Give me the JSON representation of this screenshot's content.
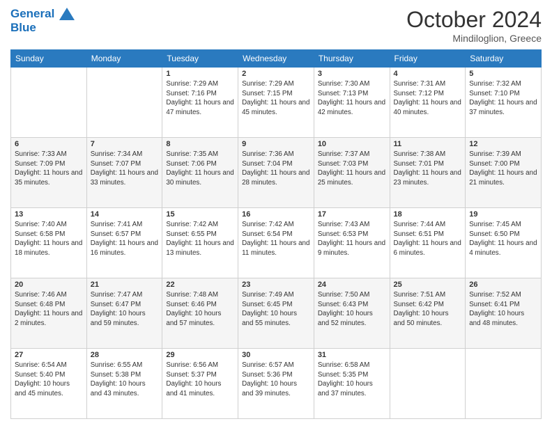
{
  "header": {
    "logo_line1": "General",
    "logo_line2": "Blue",
    "month": "October 2024",
    "location": "Mindiloglion, Greece"
  },
  "weekdays": [
    "Sunday",
    "Monday",
    "Tuesday",
    "Wednesday",
    "Thursday",
    "Friday",
    "Saturday"
  ],
  "weeks": [
    [
      {
        "day": "",
        "info": ""
      },
      {
        "day": "",
        "info": ""
      },
      {
        "day": "1",
        "info": "Sunrise: 7:29 AM\nSunset: 7:16 PM\nDaylight: 11 hours and 47 minutes."
      },
      {
        "day": "2",
        "info": "Sunrise: 7:29 AM\nSunset: 7:15 PM\nDaylight: 11 hours and 45 minutes."
      },
      {
        "day": "3",
        "info": "Sunrise: 7:30 AM\nSunset: 7:13 PM\nDaylight: 11 hours and 42 minutes."
      },
      {
        "day": "4",
        "info": "Sunrise: 7:31 AM\nSunset: 7:12 PM\nDaylight: 11 hours and 40 minutes."
      },
      {
        "day": "5",
        "info": "Sunrise: 7:32 AM\nSunset: 7:10 PM\nDaylight: 11 hours and 37 minutes."
      }
    ],
    [
      {
        "day": "6",
        "info": "Sunrise: 7:33 AM\nSunset: 7:09 PM\nDaylight: 11 hours and 35 minutes."
      },
      {
        "day": "7",
        "info": "Sunrise: 7:34 AM\nSunset: 7:07 PM\nDaylight: 11 hours and 33 minutes."
      },
      {
        "day": "8",
        "info": "Sunrise: 7:35 AM\nSunset: 7:06 PM\nDaylight: 11 hours and 30 minutes."
      },
      {
        "day": "9",
        "info": "Sunrise: 7:36 AM\nSunset: 7:04 PM\nDaylight: 11 hours and 28 minutes."
      },
      {
        "day": "10",
        "info": "Sunrise: 7:37 AM\nSunset: 7:03 PM\nDaylight: 11 hours and 25 minutes."
      },
      {
        "day": "11",
        "info": "Sunrise: 7:38 AM\nSunset: 7:01 PM\nDaylight: 11 hours and 23 minutes."
      },
      {
        "day": "12",
        "info": "Sunrise: 7:39 AM\nSunset: 7:00 PM\nDaylight: 11 hours and 21 minutes."
      }
    ],
    [
      {
        "day": "13",
        "info": "Sunrise: 7:40 AM\nSunset: 6:58 PM\nDaylight: 11 hours and 18 minutes."
      },
      {
        "day": "14",
        "info": "Sunrise: 7:41 AM\nSunset: 6:57 PM\nDaylight: 11 hours and 16 minutes."
      },
      {
        "day": "15",
        "info": "Sunrise: 7:42 AM\nSunset: 6:55 PM\nDaylight: 11 hours and 13 minutes."
      },
      {
        "day": "16",
        "info": "Sunrise: 7:42 AM\nSunset: 6:54 PM\nDaylight: 11 hours and 11 minutes."
      },
      {
        "day": "17",
        "info": "Sunrise: 7:43 AM\nSunset: 6:53 PM\nDaylight: 11 hours and 9 minutes."
      },
      {
        "day": "18",
        "info": "Sunrise: 7:44 AM\nSunset: 6:51 PM\nDaylight: 11 hours and 6 minutes."
      },
      {
        "day": "19",
        "info": "Sunrise: 7:45 AM\nSunset: 6:50 PM\nDaylight: 11 hours and 4 minutes."
      }
    ],
    [
      {
        "day": "20",
        "info": "Sunrise: 7:46 AM\nSunset: 6:48 PM\nDaylight: 11 hours and 2 minutes."
      },
      {
        "day": "21",
        "info": "Sunrise: 7:47 AM\nSunset: 6:47 PM\nDaylight: 10 hours and 59 minutes."
      },
      {
        "day": "22",
        "info": "Sunrise: 7:48 AM\nSunset: 6:46 PM\nDaylight: 10 hours and 57 minutes."
      },
      {
        "day": "23",
        "info": "Sunrise: 7:49 AM\nSunset: 6:45 PM\nDaylight: 10 hours and 55 minutes."
      },
      {
        "day": "24",
        "info": "Sunrise: 7:50 AM\nSunset: 6:43 PM\nDaylight: 10 hours and 52 minutes."
      },
      {
        "day": "25",
        "info": "Sunrise: 7:51 AM\nSunset: 6:42 PM\nDaylight: 10 hours and 50 minutes."
      },
      {
        "day": "26",
        "info": "Sunrise: 7:52 AM\nSunset: 6:41 PM\nDaylight: 10 hours and 48 minutes."
      }
    ],
    [
      {
        "day": "27",
        "info": "Sunrise: 6:54 AM\nSunset: 5:40 PM\nDaylight: 10 hours and 45 minutes."
      },
      {
        "day": "28",
        "info": "Sunrise: 6:55 AM\nSunset: 5:38 PM\nDaylight: 10 hours and 43 minutes."
      },
      {
        "day": "29",
        "info": "Sunrise: 6:56 AM\nSunset: 5:37 PM\nDaylight: 10 hours and 41 minutes."
      },
      {
        "day": "30",
        "info": "Sunrise: 6:57 AM\nSunset: 5:36 PM\nDaylight: 10 hours and 39 minutes."
      },
      {
        "day": "31",
        "info": "Sunrise: 6:58 AM\nSunset: 5:35 PM\nDaylight: 10 hours and 37 minutes."
      },
      {
        "day": "",
        "info": ""
      },
      {
        "day": "",
        "info": ""
      }
    ]
  ]
}
